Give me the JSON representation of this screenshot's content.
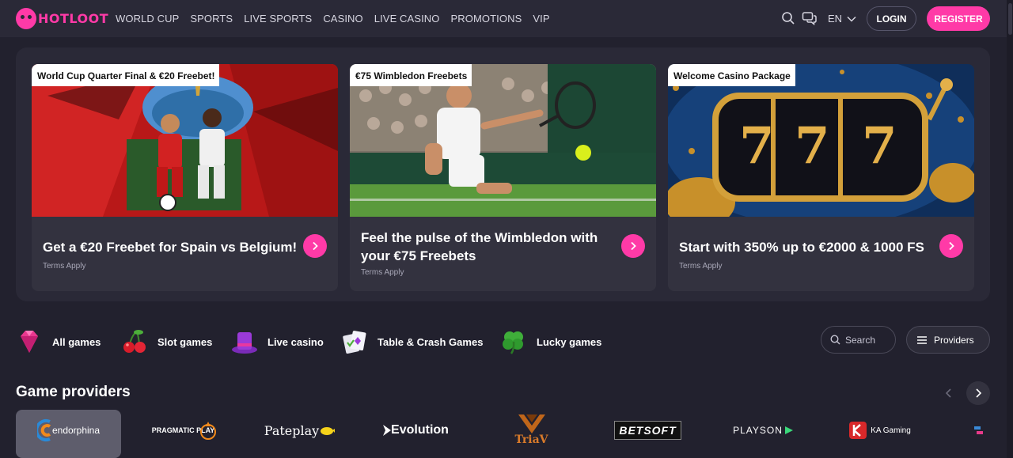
{
  "header": {
    "logo_text": "HOTLOOT",
    "nav": [
      "WORLD CUP",
      "SPORTS",
      "LIVE SPORTS",
      "CASINO",
      "LIVE CASINO",
      "PROMOTIONS",
      "VIP"
    ],
    "language": "EN",
    "login_label": "LOGIN",
    "register_label": "REGISTER"
  },
  "promos": [
    {
      "tag": "World Cup Quarter Final & €20 Freebet!",
      "title": "Get a €20 Freebet for Spain vs Belgium!",
      "terms": "Terms Apply"
    },
    {
      "tag": "€75 Wimbledon Freebets",
      "title": "Feel the pulse of the Wimbledon with your €75 Freebets",
      "terms": "Terms Apply"
    },
    {
      "tag": "Welcome Casino Package",
      "title": "Start with 350% up to €2000 & 1000 FS",
      "terms": "Terms Apply"
    }
  ],
  "categories": [
    {
      "label": "All games",
      "icon": "gem-icon"
    },
    {
      "label": "Slot games",
      "icon": "cherry-icon"
    },
    {
      "label": "Live casino",
      "icon": "top-hat-icon"
    },
    {
      "label": "Table & Crash Games",
      "icon": "cards-icon"
    },
    {
      "label": "Lucky games",
      "icon": "clover-icon"
    }
  ],
  "search_label": "Search",
  "providers_label": "Providers",
  "section_title": "Game providers",
  "providers": [
    {
      "name": "endorphina"
    },
    {
      "name": "PRAGMATIC PLAY"
    },
    {
      "name": "Pateplay"
    },
    {
      "name": "Evolution"
    },
    {
      "name": "TriaV"
    },
    {
      "name": "BETSOFT"
    },
    {
      "name": "PLAYSON"
    },
    {
      "name": "KA Gaming"
    }
  ],
  "colors": {
    "accent": "#ff3aa7",
    "background": "#22212e",
    "header": "#2a2937",
    "card": "#33323f"
  }
}
